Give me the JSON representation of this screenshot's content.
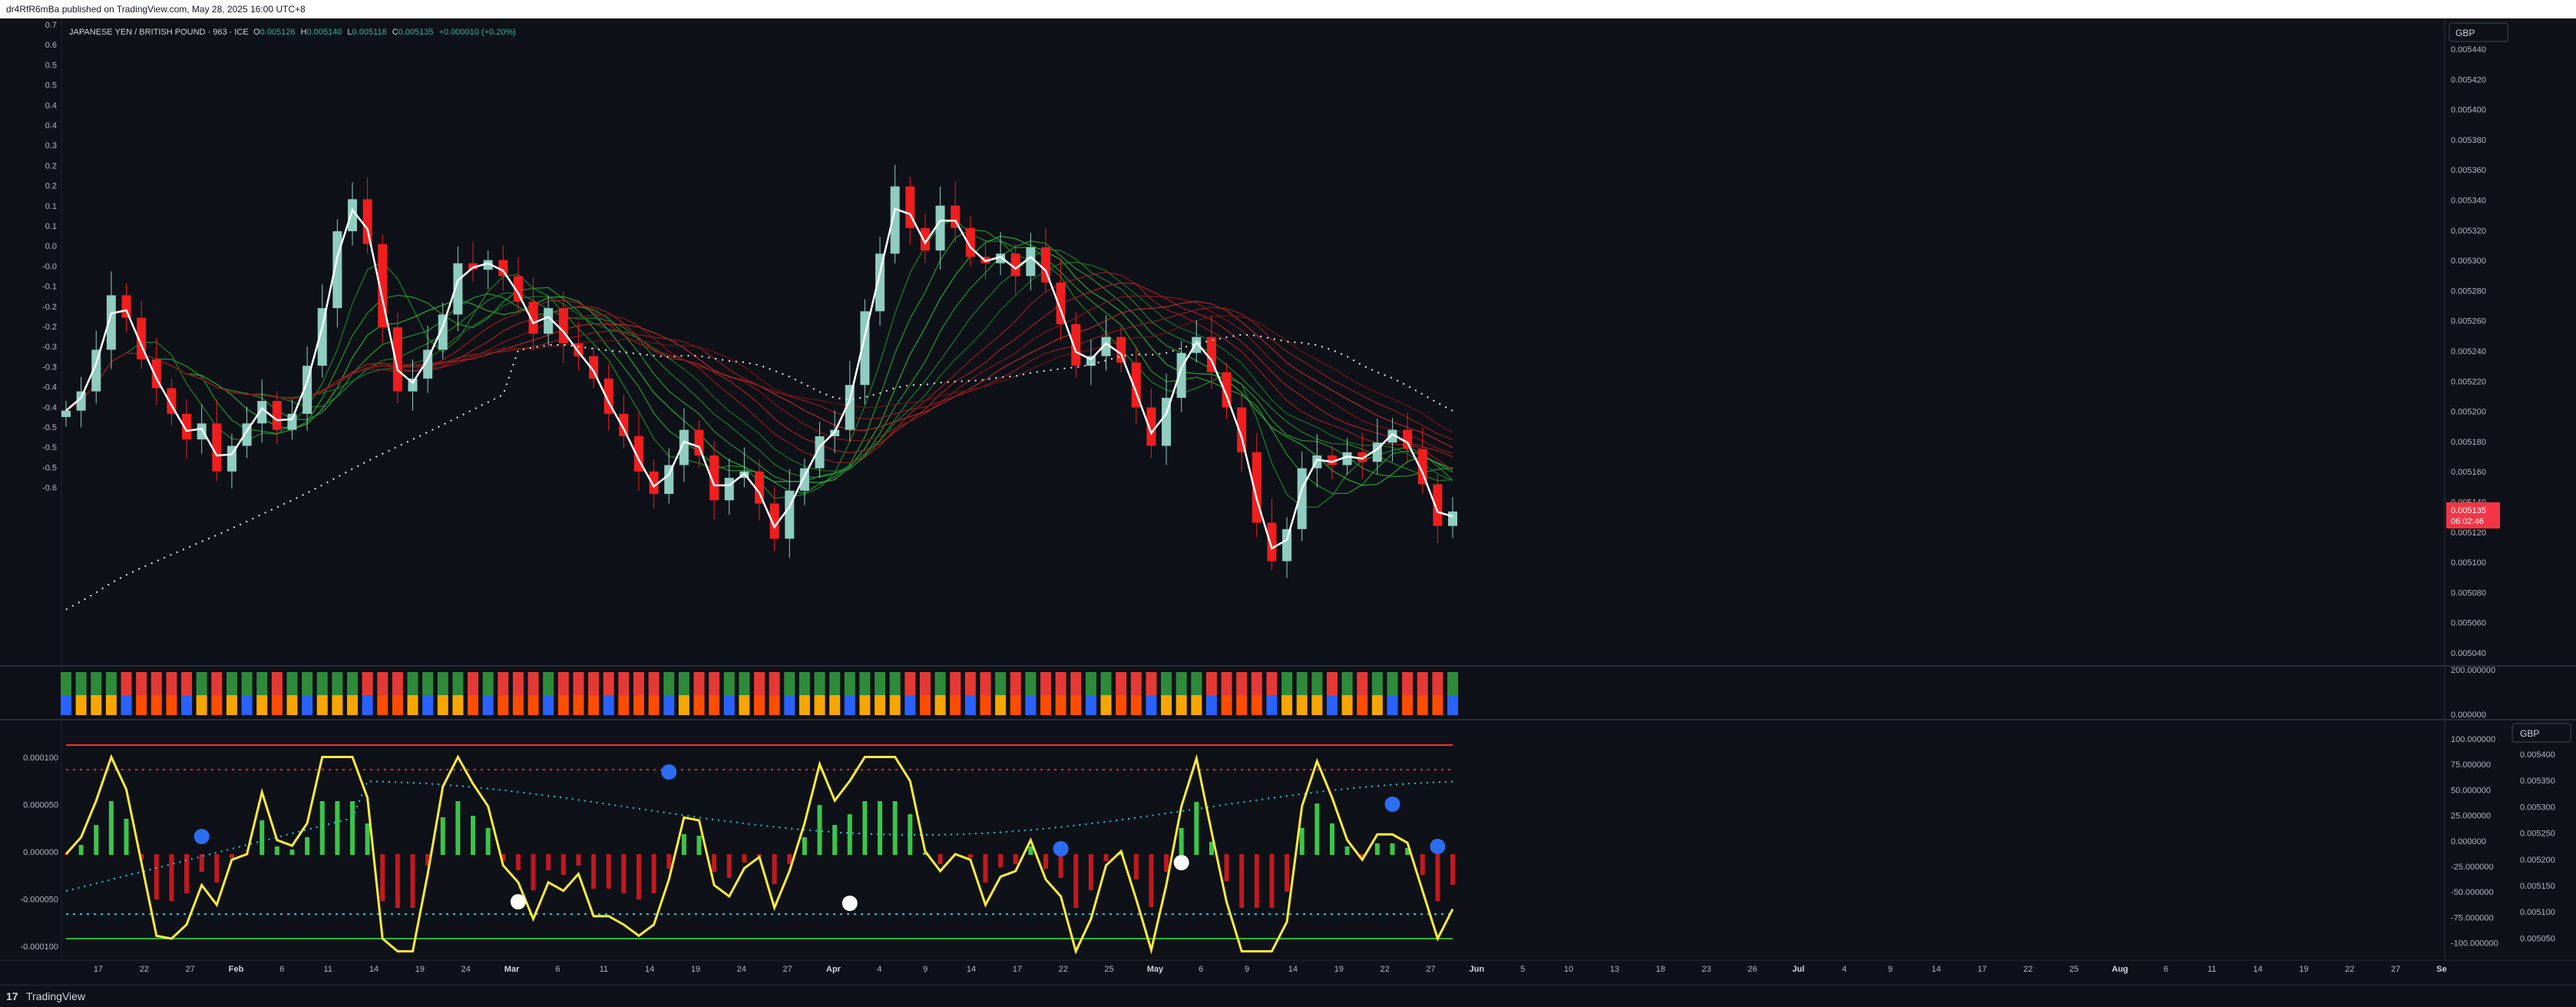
{
  "header": {
    "published": "dr4RfR6mBa published on TradingView.com, May 28, 2025 16:00 UTC+8"
  },
  "legend": {
    "symbol": "JAPANESE YEN / BRITISH POUND · 963 · ICE",
    "o_label": "O",
    "o_value": "0.005126",
    "h_label": "H",
    "h_value": "0.005140",
    "l_label": "L",
    "l_value": "0.005118",
    "c_label": "C",
    "c_value": "0.005135",
    "change": "+0.000010 (+0.20%)"
  },
  "currency_badge": "GBP",
  "currency_badge_lower": "GBP",
  "last_price": {
    "value": "0.005135",
    "countdown": "06:02:46"
  },
  "left_scale": [
    "0.7",
    "0.6",
    "0.5",
    "0.5",
    "0.4",
    "0.4",
    "0.3",
    "0.2",
    "0.2",
    "0.1",
    "0.1",
    "0.0",
    "-0.0",
    "-0.1",
    "-0.2",
    "-0.2",
    "-0.3",
    "-0.3",
    "-0.4",
    "-0.4",
    "-0.5",
    "-0.5",
    "-0.5",
    "-0.6"
  ],
  "right_scale": [
    "0.005440",
    "0.005420",
    "0.005400",
    "0.005380",
    "0.005360",
    "0.005340",
    "0.005320",
    "0.005300",
    "0.005280",
    "0.005260",
    "0.005240",
    "0.005220",
    "0.005200",
    "0.005180",
    "0.005160",
    "0.005140",
    "0.005120",
    "0.005100",
    "0.005080",
    "0.005060",
    "0.005040"
  ],
  "volume_scale": [
    "200.000000",
    "0.000000"
  ],
  "osc_left_scale": [
    "0.000100",
    "0.000050",
    "0.000000",
    "-0.000050",
    "-0.000100"
  ],
  "osc_right_scale": [
    "100.000000",
    "75.000000",
    "50.000000",
    "25.000000",
    "0.000000",
    "-25.000000",
    "-50.000000",
    "-75.000000",
    "-100.000000"
  ],
  "osc_far_right_scale": [
    "0.005400",
    "0.005350",
    "0.005300",
    "0.005250",
    "0.005200",
    "0.005150",
    "0.005100",
    "0.005050"
  ],
  "time_axis": [
    "17",
    "22",
    "27",
    "Feb",
    "6",
    "11",
    "14",
    "19",
    "24",
    "Mar",
    "6",
    "11",
    "14",
    "19",
    "24",
    "27",
    "Apr",
    "4",
    "9",
    "14",
    "17",
    "22",
    "25",
    "May",
    "6",
    "9",
    "14",
    "19",
    "22",
    "27",
    "Jun",
    "5",
    "10",
    "13",
    "18",
    "23",
    "26",
    "Jul",
    "4",
    "9",
    "14",
    "17",
    "22",
    "25",
    "Aug",
    "6",
    "11",
    "14",
    "19",
    "22",
    "27",
    "Se"
  ],
  "footer": {
    "logo": "17",
    "brand": "TradingView"
  },
  "chart_data": {
    "type": "candlestick",
    "symbol": "JAPANESE YEN / BRITISH POUND",
    "y_range": [
      0.00504,
      0.00544
    ],
    "close": [
      0.005198,
      0.00521,
      0.005236,
      0.00527,
      0.005256,
      0.00523,
      0.005212,
      0.005196,
      0.00518,
      0.00519,
      0.00516,
      0.005176,
      0.00519,
      0.005204,
      0.005186,
      0.005196,
      0.005226,
      0.005262,
      0.00531,
      0.00533,
      0.005302,
      0.00525,
      0.00521,
      0.005218,
      0.005236,
      0.005258,
      0.00529,
      0.005286,
      0.005292,
      0.005282,
      0.005266,
      0.005246,
      0.005262,
      0.00524,
      0.005232,
      0.005218,
      0.005196,
      0.005182,
      0.00516,
      0.005146,
      0.005164,
      0.005186,
      0.00517,
      0.005142,
      0.005156,
      0.00516,
      0.00514,
      0.005118,
      0.005148,
      0.005162,
      0.005182,
      0.005186,
      0.005214,
      0.00526,
      0.005296,
      0.005338,
      0.005312,
      0.005298,
      0.005326,
      0.005312,
      0.005294,
      0.00529,
      0.005296,
      0.005282,
      0.0053,
      0.005278,
      0.005252,
      0.005226,
      0.005232,
      0.005244,
      0.005228,
      0.0052,
      0.005176,
      0.005206,
      0.005234,
      0.005244,
      0.005222,
      0.0052,
      0.005172,
      0.005128,
      0.005104,
      0.005124,
      0.005162,
      0.00517,
      0.005164,
      0.005172,
      0.005166,
      0.005178,
      0.005186,
      0.005174,
      0.005152,
      0.005126,
      0.005135
    ]
  }
}
